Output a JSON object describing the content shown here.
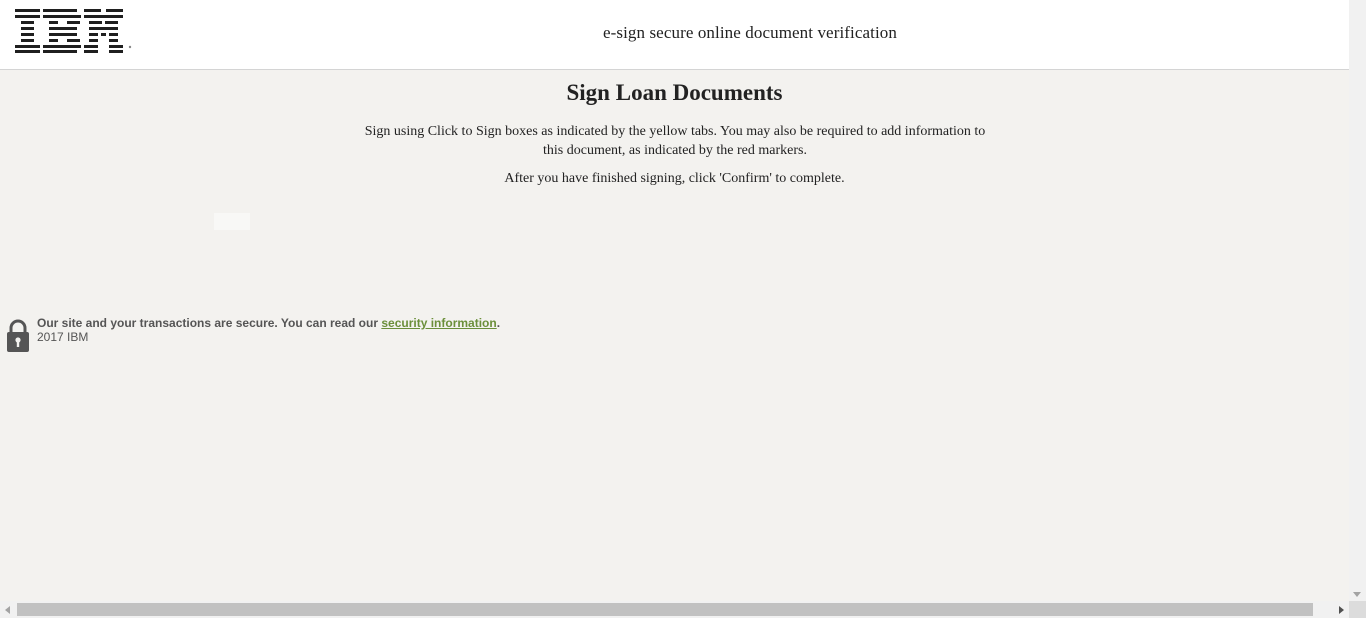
{
  "header": {
    "logo_text": "IBM",
    "title": "e-sign secure online document verification"
  },
  "main": {
    "page_title": "Sign Loan Documents",
    "instructions": "Sign using Click to Sign boxes as indicated by the yellow tabs. You may also be required to add information to this document, as indicated by the red markers.",
    "after_signing": "After you have finished signing, click 'Confirm' to complete."
  },
  "footer": {
    "security_text": "Our site and your transactions are secure. You can read our ",
    "security_link": "security information",
    "security_suffix": ".",
    "copyright": "2017 IBM"
  },
  "icons": {
    "logo": "ibm-logo",
    "lock": "lock-icon"
  },
  "colors": {
    "background": "#f3f2ef",
    "header_bg": "#ffffff",
    "link": "#6b8f3a",
    "lock": "#555555"
  }
}
